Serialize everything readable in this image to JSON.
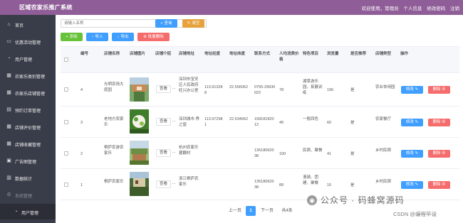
{
  "header": {
    "title": "区域农家乐推广系统",
    "welcome": "欢迎使用，管理员",
    "profile": "个人信息",
    "change_password": "修改密码",
    "logout": "注销"
  },
  "sidebar": {
    "items": [
      {
        "label": "首页",
        "icon": "home-icon"
      },
      {
        "label": "优惠活动管理",
        "icon": "tag-icon"
      },
      {
        "label": "用户管理",
        "icon": "user-icon"
      },
      {
        "label": "农家乐类别管理",
        "icon": "grid-icon"
      },
      {
        "label": "农家乐店铺管理",
        "icon": "grid-icon"
      },
      {
        "label": "预约订单管理",
        "icon": "calendar-icon"
      },
      {
        "label": "店铺评价管理",
        "icon": "grid-icon"
      },
      {
        "label": "店铺收藏管理",
        "icon": "grid-icon"
      },
      {
        "label": "广告图管理",
        "icon": "image-icon"
      },
      {
        "label": "数据统计",
        "icon": "chart-icon"
      },
      {
        "label": "系统管理",
        "icon": "settings-icon"
      },
      {
        "label": "用户管理",
        "icon": "user-icon"
      }
    ]
  },
  "toolbar": {
    "search_placeholder": "请输入名称",
    "search_label": "查询",
    "reset_label": "清空",
    "add_label": "添加",
    "import_label": "导入",
    "export_label": "导出",
    "batch_delete_label": "批量删除"
  },
  "table": {
    "columns": [
      "编号",
      "店铺名称",
      "店铺图片",
      "店铺介绍",
      "店铺地址",
      "地址经度",
      "地址纬度",
      "联系方式",
      "人均消费价格",
      "特色项目",
      "浏览量",
      "是否推荐",
      "店铺类型",
      "操作"
    ],
    "view_label": "查看",
    "edit_label": "修改",
    "delete_label": "删除",
    "rows": [
      {
        "id": "4",
        "name": "光明农场大庭园",
        "intro": "...",
        "address": "深圳市宝安区人民政府旺兴办公室",
        "lng": "113.913288",
        "lat": "22.556062",
        "phone": "0755-29930022",
        "price": "78",
        "feature": "湖草游乐园，拓展训练",
        "views": "196",
        "recommend": "是",
        "type": "农业休闲园"
      },
      {
        "id": "3",
        "name": "老地方农家乐",
        "intro": "...",
        "address": "深圳城市 界之窗",
        "lng": "113.972981",
        "lat": "22.534662",
        "phone": "15818182012",
        "price": "40",
        "feature": "一般四色",
        "views": "60",
        "recommend": "是",
        "type": "农家餐厅"
      },
      {
        "id": "2",
        "name": "桐庐农游农家乐",
        "intro": "...",
        "address": "杭州农家乐瞿翻村",
        "lng": "",
        "lat": "",
        "phone": "13518062038",
        "price": "100",
        "feature": "民宿、聚餐",
        "views": "41",
        "recommend": "是",
        "type": "乡村民宿"
      },
      {
        "id": "1",
        "name": "桐庐农家乐",
        "intro": "...",
        "address": "浙江桐庐农家乐",
        "lng": "",
        "lat": "",
        "phone": "13518062038",
        "price": "89",
        "feature": "漫骑、团建、聚餐",
        "views": "15",
        "recommend": "是",
        "type": "乡村民宿"
      }
    ]
  },
  "pagination": {
    "prev": "上一页",
    "current": "1",
    "next": "下一页",
    "total": "共4条"
  },
  "watermark": {
    "line1": "公众号 · 码蜂窝源码",
    "line2": "CSDN @编程毕设"
  },
  "colors": {
    "header": "#8f5d98",
    "sidebar": "#393d49",
    "primary": "#409eff",
    "warning": "#e6a23c",
    "success": "#67c23a",
    "danger": "#f56c6c"
  }
}
